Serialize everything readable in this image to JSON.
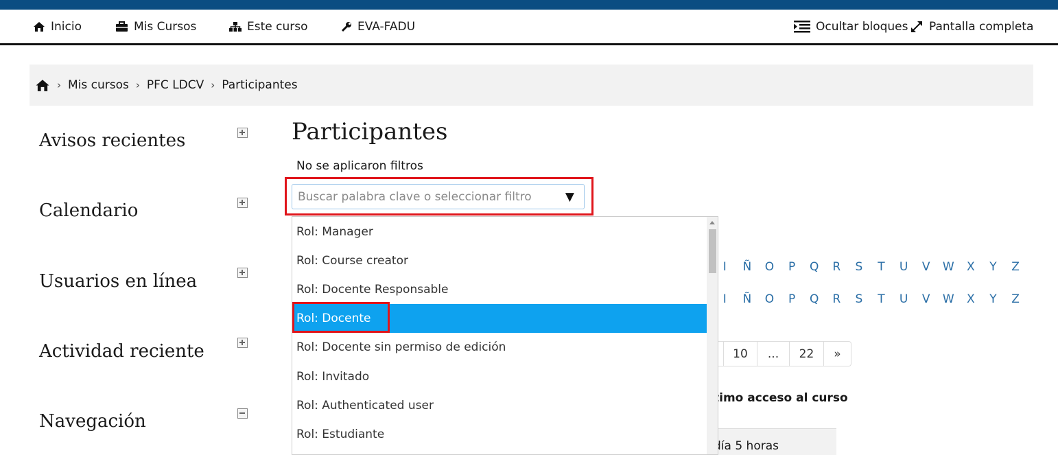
{
  "nav": {
    "items": [
      {
        "label": "Inicio",
        "icon": "home-icon"
      },
      {
        "label": "Mis Cursos",
        "icon": "briefcase-icon"
      },
      {
        "label": "Este curso",
        "icon": "sitemap-icon"
      },
      {
        "label": "EVA-FADU",
        "icon": "wrench-icon"
      }
    ],
    "hide_blocks": "Ocultar bloques",
    "fullscreen": "Pantalla completa"
  },
  "breadcrumb": {
    "items": [
      "Mis cursos",
      "PFC LDCV",
      "Participantes"
    ]
  },
  "blocks": [
    {
      "title": "Avisos recientes",
      "state": "collapsed"
    },
    {
      "title": "Calendario",
      "state": "collapsed"
    },
    {
      "title": "Usuarios en línea",
      "state": "collapsed"
    },
    {
      "title": "Actividad reciente",
      "state": "collapsed"
    },
    {
      "title": "Navegación",
      "state": "expanded"
    }
  ],
  "main": {
    "title": "Participantes",
    "filters_status": "No se aplicaron filtros",
    "search_placeholder": "Buscar palabra clave o seleccionar filtro",
    "alphabet": [
      "I",
      "Ñ",
      "O",
      "P",
      "Q",
      "R",
      "S",
      "T",
      "U",
      "V",
      "W",
      "X",
      "Y",
      "Z"
    ],
    "pagination": [
      "10",
      "...",
      "22",
      "»"
    ],
    "column_header": "timo acceso al curso",
    "cell_value": "día 5 horas"
  },
  "dropdown": {
    "options": [
      "Rol: Manager",
      "Rol: Course creator",
      "Rol: Docente Responsable",
      "Rol: Docente",
      "Rol: Docente sin permiso de edición",
      "Rol: Invitado",
      "Rol: Authenticated user",
      "Rol: Estudiante"
    ],
    "selected": "Rol: Docente"
  },
  "colors": {
    "top_stripe": "#0b4d82",
    "selected_option": "#0ea2ef",
    "link": "#2a6ea6",
    "annotation": "#e0151b"
  }
}
